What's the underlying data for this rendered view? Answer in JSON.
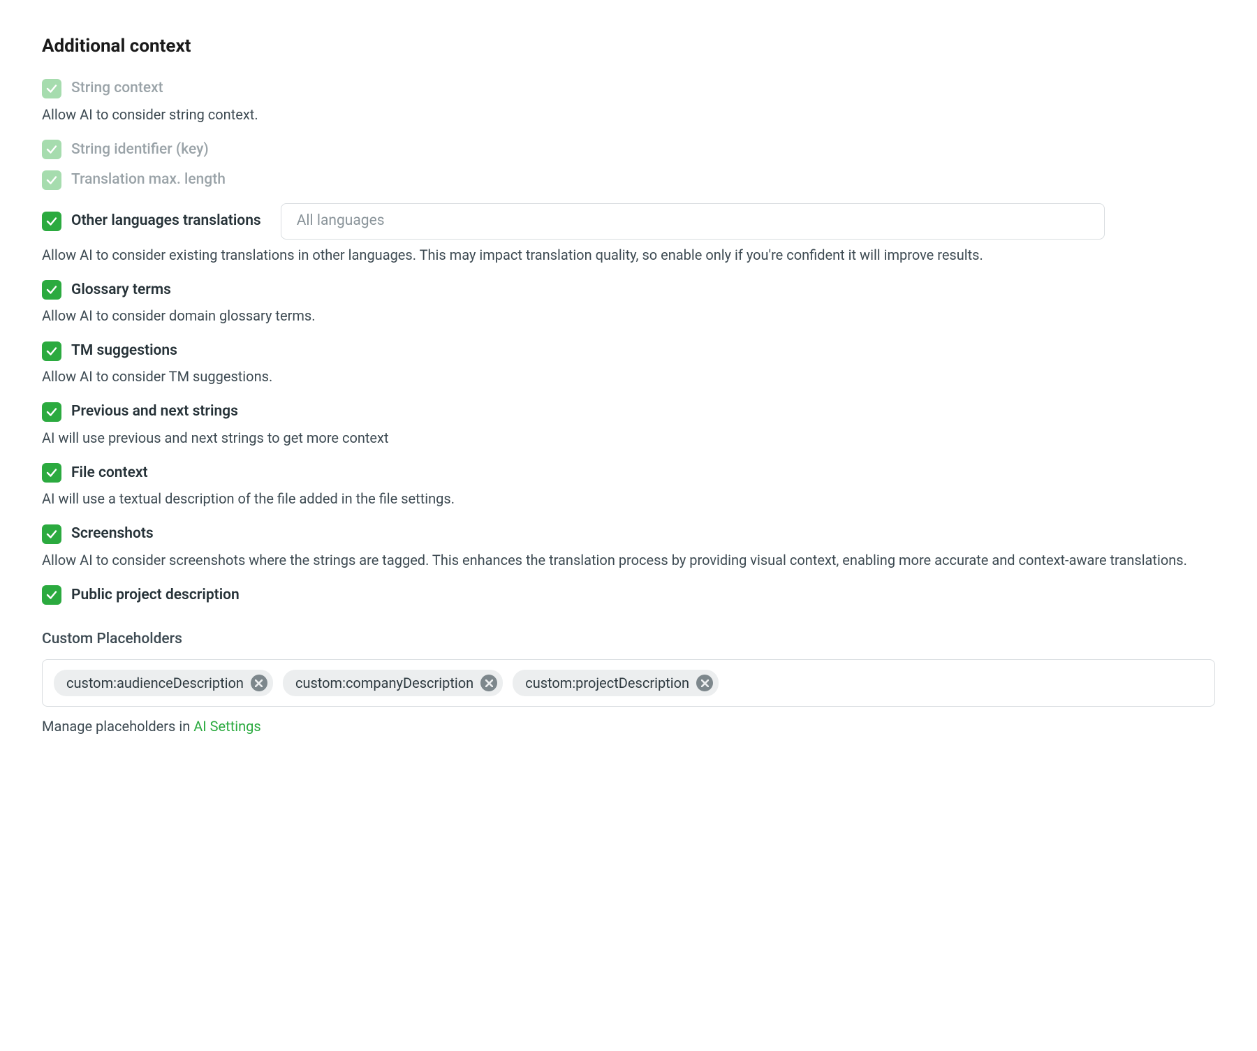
{
  "section_title": "Additional context",
  "options": {
    "string_context": {
      "label": "String context",
      "desc": "Allow AI to consider string context."
    },
    "string_identifier": {
      "label": "String identifier (key)"
    },
    "translation_max_length": {
      "label": "Translation max. length"
    },
    "other_languages": {
      "label": "Other languages translations",
      "placeholder": "All languages",
      "desc": "Allow AI to consider existing translations in other languages. This may impact translation quality, so enable only if you're confident it will improve results."
    },
    "glossary": {
      "label": "Glossary terms",
      "desc": "Allow AI to consider domain glossary terms."
    },
    "tm": {
      "label": "TM suggestions",
      "desc": "Allow AI to consider TM suggestions."
    },
    "prev_next": {
      "label": "Previous and next strings",
      "desc": "AI will use previous and next strings to get more context"
    },
    "file_context": {
      "label": "File context",
      "desc": "AI will use a textual description of the file added in the file settings."
    },
    "screenshots": {
      "label": "Screenshots",
      "desc": "Allow AI to consider screenshots where the strings are tagged. This enhances the translation process by providing visual context, enabling more accurate and context-aware translations."
    },
    "public_project": {
      "label": "Public project description"
    }
  },
  "custom_placeholders": {
    "title": "Custom Placeholders",
    "tags": [
      "custom:audienceDescription",
      "custom:companyDescription",
      "custom:projectDescription"
    ],
    "footer_prefix": "Manage placeholders in ",
    "footer_link": "AI Settings"
  }
}
